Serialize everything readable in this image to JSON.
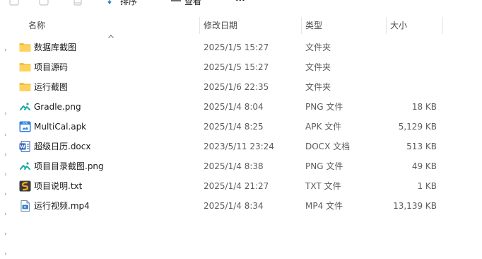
{
  "toolbar": {
    "sort_label": "排序",
    "view_label": "查看",
    "more_label": "···"
  },
  "columns": {
    "name": "名称",
    "date": "修改日期",
    "type": "类型",
    "size": "大小"
  },
  "files": [
    {
      "name": "数据库截图",
      "date": "2025/1/5 15:27",
      "type": "文件夹",
      "size": "",
      "icon": "folder-icon"
    },
    {
      "name": "项目源码",
      "date": "2025/1/5 15:27",
      "type": "文件夹",
      "size": "",
      "icon": "folder-icon"
    },
    {
      "name": "运行截图",
      "date": "2025/1/6 22:35",
      "type": "文件夹",
      "size": "",
      "icon": "folder-icon"
    },
    {
      "name": "Gradle.png",
      "date": "2025/1/4 8:04",
      "type": "PNG 文件",
      "size": "18 KB",
      "icon": "image-icon"
    },
    {
      "name": "MultiCal.apk",
      "date": "2025/1/4 8:25",
      "type": "APK 文件",
      "size": "5,129 KB",
      "icon": "apk-icon"
    },
    {
      "name": "超级日历.docx",
      "date": "2023/5/11 23:24",
      "type": "DOCX 文档",
      "size": "513 KB",
      "icon": "word-document-icon"
    },
    {
      "name": "项目目录截图.png",
      "date": "2025/1/4 8:38",
      "type": "PNG 文件",
      "size": "49 KB",
      "icon": "image-icon"
    },
    {
      "name": "项目说明.txt",
      "date": "2025/1/4 21:27",
      "type": "TXT 文件",
      "size": "1 KB",
      "icon": "text-file-icon"
    },
    {
      "name": "运行视频.mp4",
      "date": "2025/1/4 8:34",
      "type": "MP4 文件",
      "size": "13,139 KB",
      "icon": "video-file-icon"
    }
  ]
}
